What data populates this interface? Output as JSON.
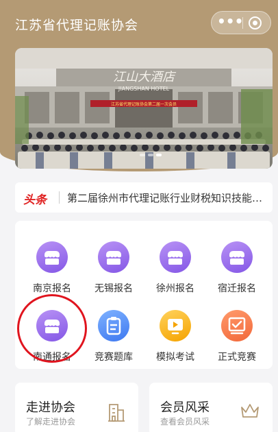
{
  "app": {
    "title": "江苏省代理记账协会"
  },
  "capsule": {
    "more_icon": "more-dots-icon",
    "close_icon": "target-circle-icon"
  },
  "banner": {
    "hotel_sign_cn": "江山大酒店",
    "hotel_sign_en": "JIANGSHAN HOTEL",
    "meeting_banner": "江苏省代理记账协会第二届一次会员",
    "slides": 3,
    "active_slide": 2
  },
  "news": {
    "tag": "头条",
    "headline": "第二届徐州市代理记账行业财税知识技能竞…"
  },
  "grid": [
    {
      "label": "南京报名",
      "icon": "shop-icon",
      "color": "purple"
    },
    {
      "label": "无锡报名",
      "icon": "shop-icon",
      "color": "purple"
    },
    {
      "label": "徐州报名",
      "icon": "shop-icon",
      "color": "purple"
    },
    {
      "label": "宿迁报名",
      "icon": "shop-icon",
      "color": "purple"
    },
    {
      "label": "南通报名",
      "icon": "shop-icon",
      "color": "purple"
    },
    {
      "label": "竞赛题库",
      "icon": "clipboard-icon",
      "color": "blue"
    },
    {
      "label": "模拟考试",
      "icon": "play-screen-icon",
      "color": "yellow"
    },
    {
      "label": "正式竞赛",
      "icon": "exam-board-icon",
      "color": "orange"
    }
  ],
  "bottom": [
    {
      "title": "走进协会",
      "subtitle": "了解走进协会",
      "icon": "building-icon"
    },
    {
      "title": "会员风采",
      "subtitle": "查看会员风采",
      "icon": "crown-icon"
    }
  ],
  "colors": {
    "brand": "#b49a74",
    "headline_tag": "#e02424",
    "highlight_circle": "#e0141e"
  }
}
